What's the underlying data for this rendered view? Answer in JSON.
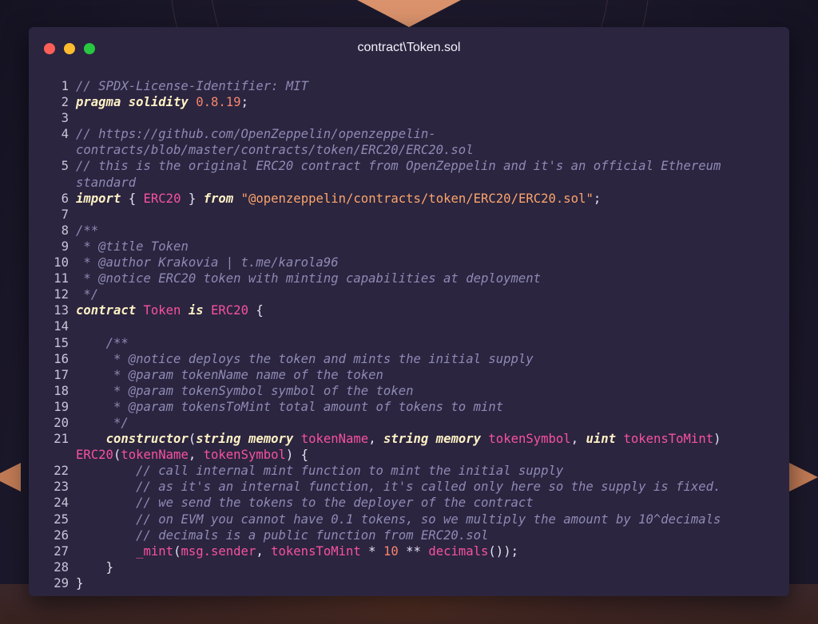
{
  "window": {
    "title": "contract\\Token.sol"
  },
  "code": [
    {
      "n": "1",
      "t": [
        {
          "c": "cm",
          "v": "// SPDX-License-Identifier: MIT"
        }
      ]
    },
    {
      "n": "2",
      "t": [
        {
          "c": "kw",
          "v": "pragma solidity"
        },
        {
          "c": "pl",
          "v": " "
        },
        {
          "c": "num",
          "v": "0.8.19"
        },
        {
          "c": "pl",
          "v": ";"
        }
      ]
    },
    {
      "n": "3",
      "t": []
    },
    {
      "n": "4",
      "t": [
        {
          "c": "cm",
          "v": "// https://github.com/OpenZeppelin/openzeppelin-\ncontracts/blob/master/contracts/token/ERC20/ERC20.sol"
        }
      ]
    },
    {
      "n": "5",
      "t": [
        {
          "c": "cm",
          "v": "// this is the original ERC20 contract from OpenZeppelin and it's an official Ethereum\nstandard"
        }
      ]
    },
    {
      "n": "6",
      "t": [
        {
          "c": "kw",
          "v": "import"
        },
        {
          "c": "pl",
          "v": " { "
        },
        {
          "c": "nm",
          "v": "ERC20"
        },
        {
          "c": "pl",
          "v": " } "
        },
        {
          "c": "kw",
          "v": "from"
        },
        {
          "c": "pl",
          "v": " "
        },
        {
          "c": "str",
          "v": "\"@openzeppelin/contracts/token/ERC20/ERC20.sol\""
        },
        {
          "c": "pl",
          "v": ";"
        }
      ]
    },
    {
      "n": "7",
      "t": []
    },
    {
      "n": "8",
      "t": [
        {
          "c": "cm",
          "v": "/**"
        }
      ]
    },
    {
      "n": "9",
      "t": [
        {
          "c": "cm",
          "v": " * @title Token"
        }
      ]
    },
    {
      "n": "10",
      "t": [
        {
          "c": "cm",
          "v": " * @author Krakovia | t.me/karola96"
        }
      ]
    },
    {
      "n": "11",
      "t": [
        {
          "c": "cm",
          "v": " * @notice ERC20 token with minting capabilities at deployment"
        }
      ]
    },
    {
      "n": "12",
      "t": [
        {
          "c": "cm",
          "v": " */"
        }
      ]
    },
    {
      "n": "13",
      "t": [
        {
          "c": "kw",
          "v": "contract"
        },
        {
          "c": "pl",
          "v": " "
        },
        {
          "c": "nm",
          "v": "Token"
        },
        {
          "c": "pl",
          "v": " "
        },
        {
          "c": "kw",
          "v": "is"
        },
        {
          "c": "pl",
          "v": " "
        },
        {
          "c": "nm",
          "v": "ERC20"
        },
        {
          "c": "pl",
          "v": " {"
        }
      ]
    },
    {
      "n": "14",
      "t": []
    },
    {
      "n": "15",
      "t": [
        {
          "c": "cm",
          "v": "    /**"
        }
      ]
    },
    {
      "n": "16",
      "t": [
        {
          "c": "cm",
          "v": "     * @notice deploys the token and mints the initial supply"
        }
      ]
    },
    {
      "n": "17",
      "t": [
        {
          "c": "cm",
          "v": "     * @param tokenName name of the token"
        }
      ]
    },
    {
      "n": "18",
      "t": [
        {
          "c": "cm",
          "v": "     * @param tokenSymbol symbol of the token"
        }
      ]
    },
    {
      "n": "19",
      "t": [
        {
          "c": "cm",
          "v": "     * @param tokensToMint total amount of tokens to mint"
        }
      ]
    },
    {
      "n": "20",
      "t": [
        {
          "c": "cm",
          "v": "     */"
        }
      ]
    },
    {
      "n": "21",
      "t": [
        {
          "c": "pl",
          "v": "    "
        },
        {
          "c": "kw",
          "v": "constructor"
        },
        {
          "c": "pl",
          "v": "("
        },
        {
          "c": "kw",
          "v": "string memory"
        },
        {
          "c": "pl",
          "v": " "
        },
        {
          "c": "nm",
          "v": "tokenName"
        },
        {
          "c": "pl",
          "v": ", "
        },
        {
          "c": "kw",
          "v": "string memory"
        },
        {
          "c": "pl",
          "v": " "
        },
        {
          "c": "nm",
          "v": "tokenSymbol"
        },
        {
          "c": "pl",
          "v": ", "
        },
        {
          "c": "kw",
          "v": "uint"
        },
        {
          "c": "pl",
          "v": " "
        },
        {
          "c": "nm",
          "v": "tokensToMint"
        },
        {
          "c": "pl",
          "v": ")\n"
        },
        {
          "c": "nm",
          "v": "ERC20"
        },
        {
          "c": "pl",
          "v": "("
        },
        {
          "c": "nm",
          "v": "tokenName"
        },
        {
          "c": "pl",
          "v": ", "
        },
        {
          "c": "nm",
          "v": "tokenSymbol"
        },
        {
          "c": "pl",
          "v": ") {"
        }
      ]
    },
    {
      "n": "22",
      "t": [
        {
          "c": "cm",
          "v": "        // call internal mint function to mint the initial supply"
        }
      ]
    },
    {
      "n": "23",
      "t": [
        {
          "c": "cm",
          "v": "        // as it's an internal function, it's called only here so the supply is fixed."
        }
      ]
    },
    {
      "n": "24",
      "t": [
        {
          "c": "cm",
          "v": "        // we send the tokens to the deployer of the contract"
        }
      ]
    },
    {
      "n": "25",
      "t": [
        {
          "c": "cm",
          "v": "        // on EVM you cannot have 0.1 tokens, so we multiply the amount by 10^decimals"
        }
      ]
    },
    {
      "n": "26",
      "t": [
        {
          "c": "cm",
          "v": "        // decimals is a public function from ERC20.sol"
        }
      ]
    },
    {
      "n": "27",
      "t": [
        {
          "c": "pl",
          "v": "        "
        },
        {
          "c": "nm",
          "v": "_mint"
        },
        {
          "c": "pl",
          "v": "("
        },
        {
          "c": "nm",
          "v": "msg.sender"
        },
        {
          "c": "pl",
          "v": ", "
        },
        {
          "c": "nm",
          "v": "tokensToMint"
        },
        {
          "c": "pl",
          "v": " * "
        },
        {
          "c": "num",
          "v": "10"
        },
        {
          "c": "pl",
          "v": " ** "
        },
        {
          "c": "nm",
          "v": "decimals"
        },
        {
          "c": "pl",
          "v": "());"
        }
      ]
    },
    {
      "n": "28",
      "t": [
        {
          "c": "pl",
          "v": "    }"
        }
      ]
    },
    {
      "n": "29",
      "t": [
        {
          "c": "pl",
          "v": "}"
        }
      ]
    }
  ]
}
